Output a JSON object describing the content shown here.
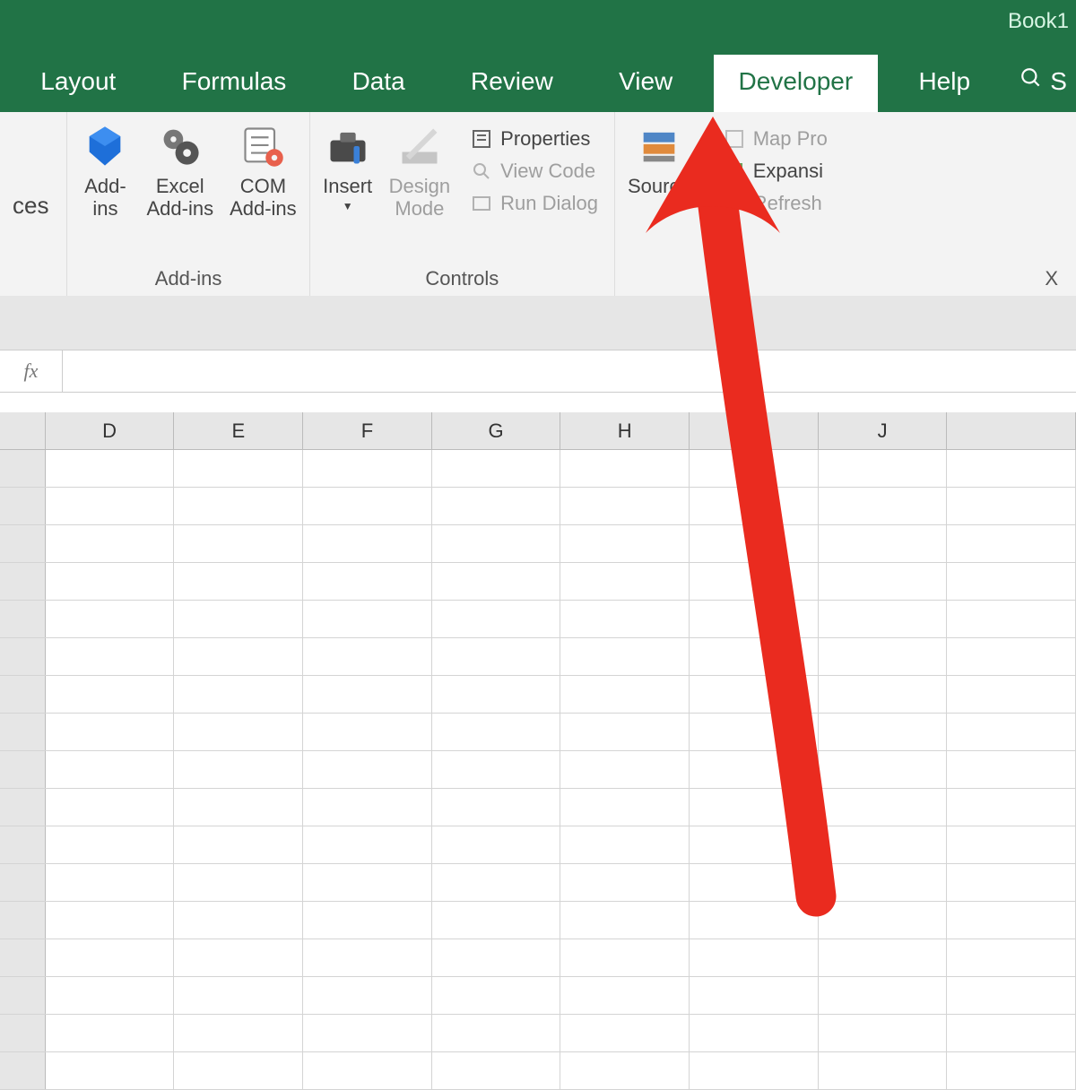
{
  "title": "Book1",
  "tabs": {
    "layout": "Layout",
    "formulas": "Formulas",
    "data": "Data",
    "review": "Review",
    "view": "View",
    "developer": "Developer",
    "help": "Help",
    "search": "S"
  },
  "ribbon": {
    "left_truncated": "ces",
    "addins": {
      "addins": "Add-\nins",
      "excel_addins": "Excel\nAdd-ins",
      "com_addins": "COM\nAdd-ins",
      "group": "Add-ins"
    },
    "controls": {
      "insert": "Insert",
      "design_mode": "Design\nMode",
      "properties": "Properties",
      "view_code": "View Code",
      "run_dialog": "Run Dialog",
      "group": "Controls"
    },
    "xml": {
      "source": "Source",
      "map_properties": "Map Pro",
      "expansion": "Expansi",
      "refresh": "Refresh"
    }
  },
  "formula_bar": {
    "fx": "fx",
    "value": ""
  },
  "columns": [
    "D",
    "E",
    "F",
    "G",
    "H",
    "",
    "J",
    ""
  ],
  "colors": {
    "excel_green": "#217346",
    "arrow_red": "#ea2b1f"
  }
}
